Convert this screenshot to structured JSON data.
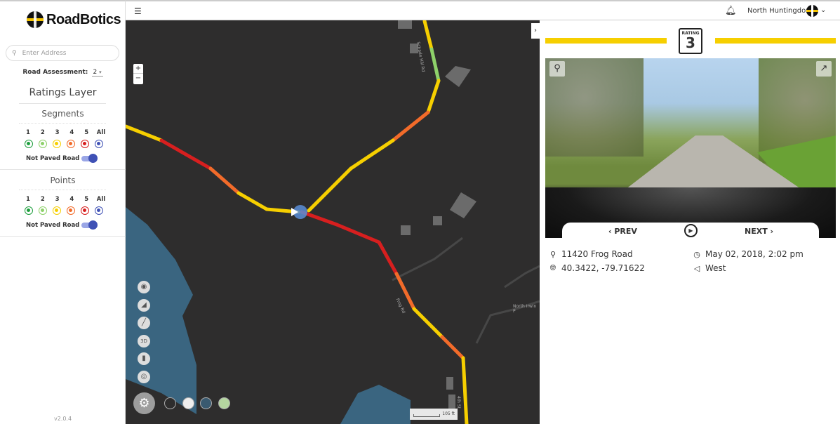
{
  "brand": {
    "name": "RoadBotics"
  },
  "sidebar": {
    "search_placeholder": "Enter Address",
    "assessment_label": "Road Assessment:",
    "assessment_value": "2",
    "layer_title": "Ratings Layer",
    "segments": {
      "title": "Segments",
      "levels": [
        "1",
        "2",
        "3",
        "4",
        "5",
        "All"
      ],
      "not_paved_label": "Not Paved Road",
      "not_paved_on": true
    },
    "points": {
      "title": "Points",
      "levels": [
        "1",
        "2",
        "3",
        "4",
        "5",
        "All"
      ],
      "not_paved_label": "Not Paved Road",
      "not_paved_on": true
    },
    "version": "v2.0.4"
  },
  "rating_colors": [
    "#1e9e3e",
    "#8ed16a",
    "#f6cf00",
    "#f26b2a",
    "#d71f1f",
    "#3f51b5"
  ],
  "topbar": {
    "menu_icon": "hamburger-icon",
    "notification_icon": "bell-icon",
    "town": "North Huntingdon"
  },
  "map": {
    "zoom_in": "+",
    "zoom_out": "−",
    "labels": {
      "road1": "Schade Hill Rd",
      "road2": "Frog Rd",
      "road3": "4th St",
      "place": "North Irwin P"
    },
    "scale": "105 ft",
    "tools": [
      "camera-icon",
      "angle-measure-icon",
      "ruler-icon",
      "3d-icon",
      "trash-icon",
      "locate-icon"
    ]
  },
  "panel": {
    "rating_label": "RATING",
    "rating_value": "3",
    "rating_color": "#f6cf00",
    "prev": "‹ PREV",
    "next": "NEXT ›",
    "address": "11420 Frog Road",
    "coords": "40.3422, -79.71622",
    "datetime": "May 02, 2018, 2:02 pm",
    "direction": "West"
  }
}
